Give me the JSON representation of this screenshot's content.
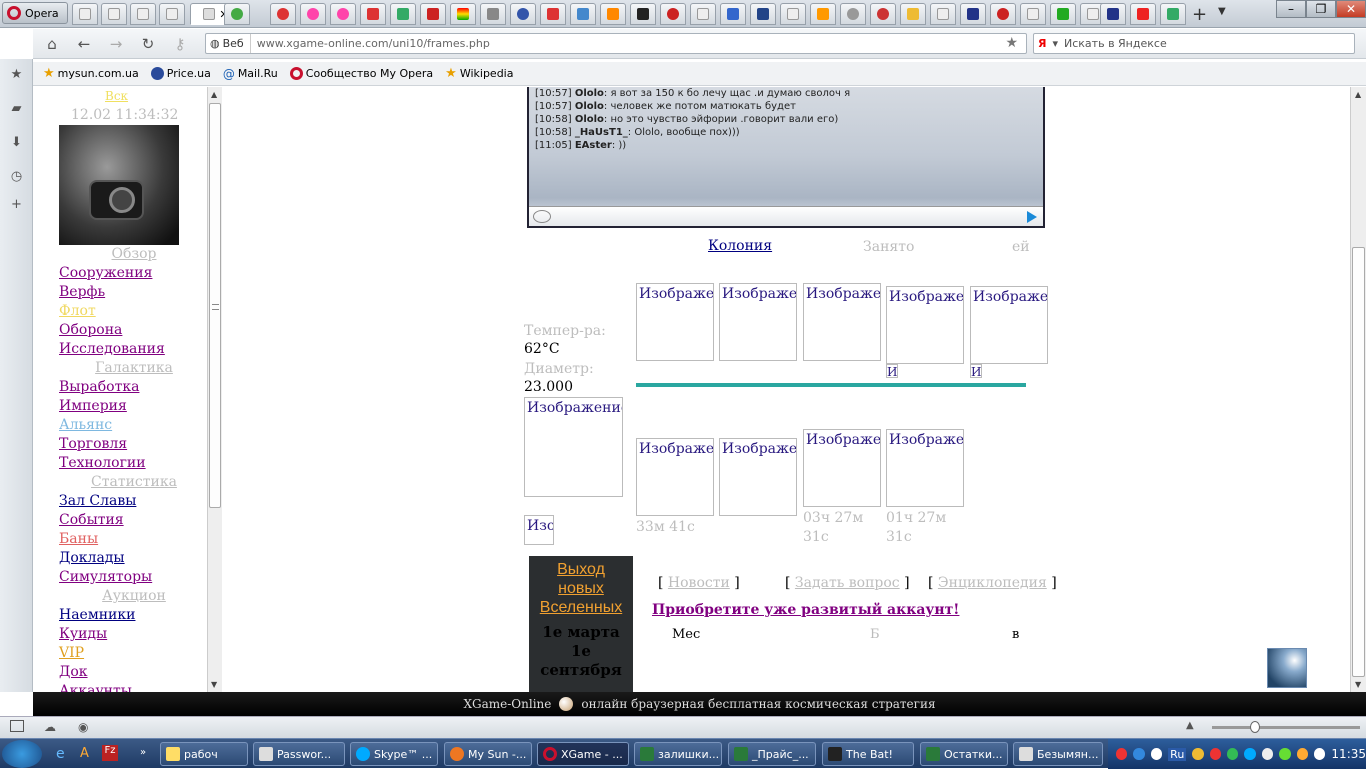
{
  "browser": {
    "opera_label": "Opera",
    "address_mode": "Веб",
    "url": "www.xgame-online.com/uni10/frames.php",
    "search_placeholder": "Искать в Яндексе",
    "bookmarks": [
      "mysun.com.ua",
      "Price.ua",
      "Mail.Ru",
      "Сообщество My Opera",
      "Wikipedia"
    ]
  },
  "left": {
    "top_link": "Вск",
    "timestamp": "12.02 11:34:32",
    "overview": "Обзор",
    "nav": [
      {
        "label": "Сооружения",
        "color": "#800080"
      },
      {
        "label": "Верфь",
        "color": "#800080"
      },
      {
        "label": "Флот",
        "color": "#f0d860"
      },
      {
        "label": "Оборона",
        "color": "#800080"
      },
      {
        "label": "Исследования",
        "color": "#800080"
      }
    ],
    "galaxy": "Галактика",
    "nav2": [
      {
        "label": "Выработка",
        "color": "#800080"
      },
      {
        "label": "Империя",
        "color": "#800080"
      },
      {
        "label": "Альянс",
        "color": "#7eb8e0"
      },
      {
        "label": "Торговля",
        "color": "#800080"
      },
      {
        "label": "Технологии",
        "color": "#800080"
      }
    ],
    "stats": "Статистика",
    "nav3": [
      {
        "label": "Зал Славы",
        "color": "#000080"
      },
      {
        "label": "События",
        "color": "#800080"
      },
      {
        "label": "Баны",
        "color": "#e06060"
      },
      {
        "label": "Доклады",
        "color": "#000080"
      },
      {
        "label": "Симуляторы",
        "color": "#800080"
      }
    ],
    "auction": "Аукцион",
    "nav4": [
      {
        "label": "Наемники",
        "color": "#000080"
      },
      {
        "label": "Куиды",
        "color": "#800080"
      },
      {
        "label": "VIP",
        "color": "#e0a020"
      },
      {
        "label": "Док",
        "color": "#800080"
      },
      {
        "label": "Аккаунты",
        "color": "#800080"
      }
    ]
  },
  "chat": {
    "lines": [
      {
        "time": "[10:57]",
        "nick": "Ololo",
        "text": ": я вот за 150 к бо лечу щас .и думаю сволоч я"
      },
      {
        "time": "[10:57]",
        "nick": "Ololo",
        "text": ": человек же потом матюкать будет"
      },
      {
        "time": "[10:58]",
        "nick": "Ololo",
        "text": ": но это чувство эйфории .говорит вали его)"
      },
      {
        "time": "[10:58]",
        "nick": "_HaUsT1_",
        "text": ": Ololo, вообще пох)))"
      },
      {
        "time": "[11:05]",
        "nick": "EAster",
        "text": ": ))"
      }
    ]
  },
  "planet": {
    "colony_link": "Колония",
    "occupied": "Занято",
    "fields_tail": "ей",
    "temp_label": "Темпер-ра:",
    "temp_value": "62°C",
    "diam_label": "Диаметр:",
    "diam_value": "23.000",
    "img_alt": "Изображение",
    "img_alt_short": "Изображен",
    "img_alt_tiny": "Изоб",
    "img_alt_i": "И",
    "timer1": "33м 41с",
    "timer2a": "03ч 27м",
    "timer2b": "31с",
    "timer3a": "01ч 27м",
    "timer3b": "31с"
  },
  "promo": {
    "title_line1": "Выход",
    "title_line2": "новых",
    "title_line3": "Вселенных",
    "date1": "1е марта",
    "date2": "1е",
    "date3": "сентября"
  },
  "links": {
    "news": "Новости",
    "ask": "Задать вопрос",
    "encyclopedia": "Энциклопедия",
    "buy_account": "Приобретите уже развитый аккаунт!",
    "tail1": "Мес",
    "tail2": "Б",
    "tail3": "в"
  },
  "footer": {
    "brand": "XGame-Online",
    "tagline": "онлайн браузерная бесплатная космическая стратегия"
  },
  "taskbar": {
    "items": [
      "рабоч",
      "Passwor...",
      "Skype™ ...",
      "My Sun -...",
      "XGame - ...",
      "залишки...",
      "_Прайс_...",
      "The Bat!",
      "Остатки...",
      "Безымян..."
    ],
    "lang": "Ru",
    "clock": "11:35"
  }
}
